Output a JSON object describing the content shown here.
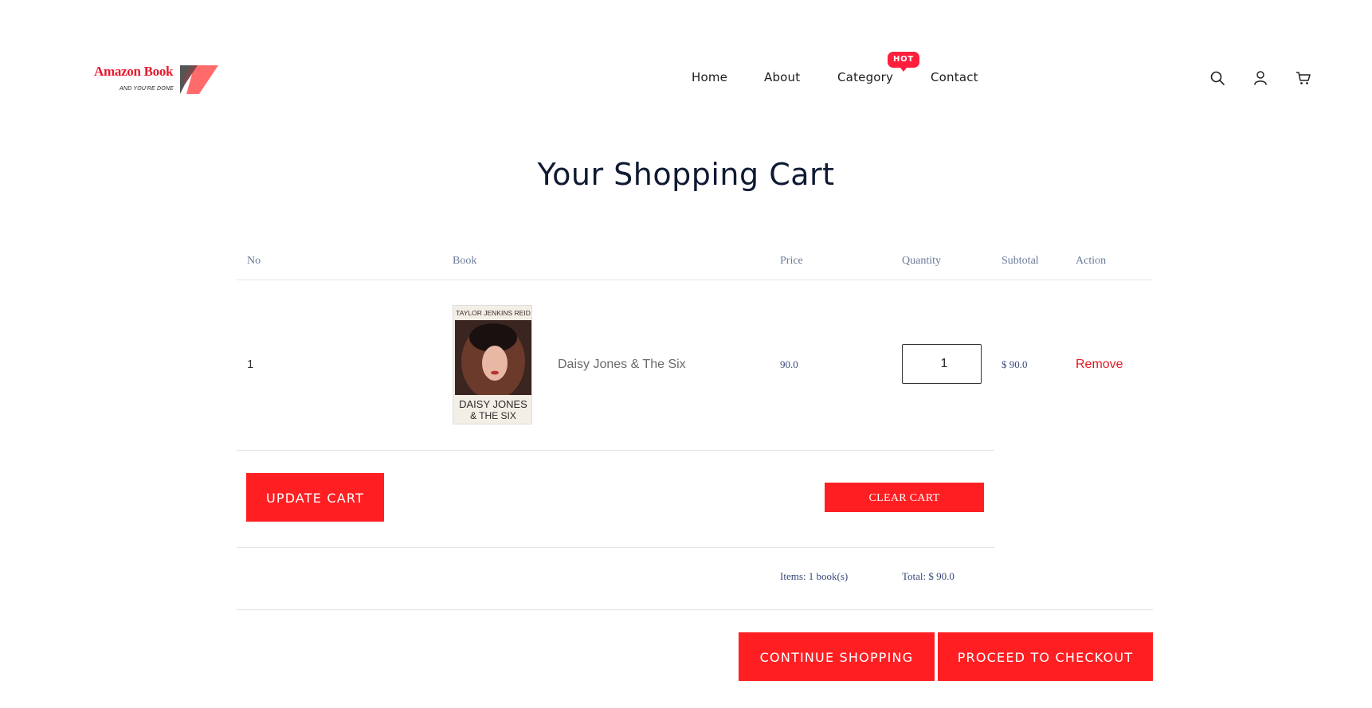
{
  "brand": {
    "name": "Amazon Book",
    "tagline": "AND YOU'RE DONE"
  },
  "nav": {
    "items": [
      "Home",
      "About",
      "Category",
      "Contact"
    ],
    "hot_badge": "HOT"
  },
  "header_icons": [
    "search-icon",
    "user-icon",
    "cart-icon"
  ],
  "page_title": "Your Shopping Cart",
  "table": {
    "headers": {
      "no": "No",
      "book": "Book",
      "price": "Price",
      "quantity": "Quantity",
      "subtotal": "Subtotal",
      "action": "Action"
    },
    "rows": [
      {
        "no": "1",
        "cover": {
          "author": "TAYLOR JENKINS REID",
          "title_line1": "DAISY JONES",
          "title_line2": "& THE SIX"
        },
        "book": "Daisy Jones & The Six",
        "price": "90.0",
        "quantity": "1",
        "subtotal": "$ 90.0",
        "action": "Remove"
      }
    ]
  },
  "buttons": {
    "update_cart": "UPDATE CART",
    "clear_cart": "CLEAR CART",
    "continue_shopping": "CONTINUE SHOPPING",
    "proceed_checkout": "PROCEED TO CHECKOUT"
  },
  "summary": {
    "items": "Items: 1 book(s)",
    "total": "Total: $ 90.0"
  },
  "colors": {
    "accent": "#ff1f23",
    "title": "#0f1a33",
    "muted_header": "#6b7b99",
    "value_text": "#3a4a7a"
  }
}
